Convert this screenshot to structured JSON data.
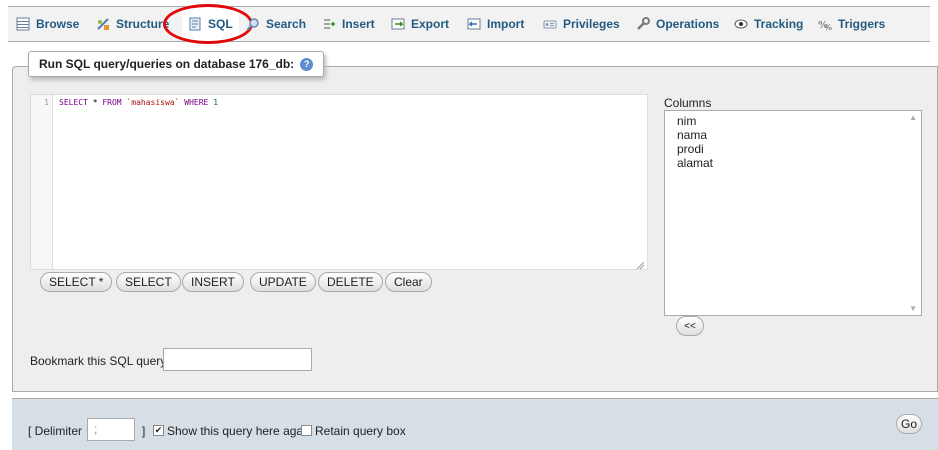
{
  "tabs": [
    {
      "label": "Browse",
      "icon": "browse-icon"
    },
    {
      "label": "Structure",
      "icon": "structure-icon"
    },
    {
      "label": "SQL",
      "icon": "sql-icon"
    },
    {
      "label": "Search",
      "icon": "search-icon"
    },
    {
      "label": "Insert",
      "icon": "insert-icon"
    },
    {
      "label": "Export",
      "icon": "export-icon"
    },
    {
      "label": "Import",
      "icon": "import-icon"
    },
    {
      "label": "Privileges",
      "icon": "privileges-icon"
    },
    {
      "label": "Operations",
      "icon": "operations-icon"
    },
    {
      "label": "Tracking",
      "icon": "tracking-icon"
    },
    {
      "label": "Triggers",
      "icon": "triggers-icon"
    }
  ],
  "active_tab": "SQL",
  "highlight_color": "#e3070e",
  "query_box": {
    "legend": "Run SQL query/queries on database 176_db:",
    "line_number": "1",
    "query": {
      "k1": "SELECT",
      "p1": " * ",
      "k2": "FROM",
      "p2": " ",
      "tbl": "`mahasiswa`",
      "p3": " ",
      "k3": "WHERE",
      "p4": " ",
      "n1": "1"
    },
    "buttons": {
      "select_all": "SELECT *",
      "select": "SELECT",
      "insert": "INSERT",
      "update": "UPDATE",
      "delete": "DELETE",
      "clear": "Clear"
    }
  },
  "columns": {
    "label": "Columns",
    "items": [
      "nim",
      "nama",
      "prodi",
      "alamat"
    ],
    "insert_button": "<<"
  },
  "bookmark": {
    "label": "Bookmark this SQL query:",
    "value": ""
  },
  "footer": {
    "delimiter_open": "[ Delimiter",
    "delimiter_value": ";",
    "delimiter_close": "]",
    "show_query_again": {
      "label": "Show this query here again",
      "checked": true
    },
    "retain_query_box": {
      "label": "Retain query box",
      "checked": false
    },
    "go": "Go"
  }
}
